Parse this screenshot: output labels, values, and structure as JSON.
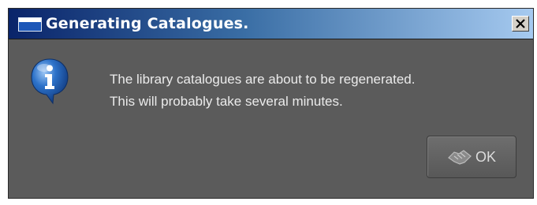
{
  "window": {
    "title": "Generating Catalogues.",
    "icon": "window-icon",
    "close_icon": "close-icon"
  },
  "message": {
    "icon": "info-icon",
    "lines": [
      "The library catalogues are about to be regenerated.",
      "This will probably take several minutes."
    ]
  },
  "buttons": {
    "ok_label": "OK",
    "ok_icon": "handshake-icon"
  },
  "colors": {
    "titlebar_start": "#0a246a",
    "titlebar_end": "#a6caf0",
    "dialog_background": "#5b5b5b",
    "message_text": "#ebebeb",
    "info_icon": "#1e5fb5"
  }
}
